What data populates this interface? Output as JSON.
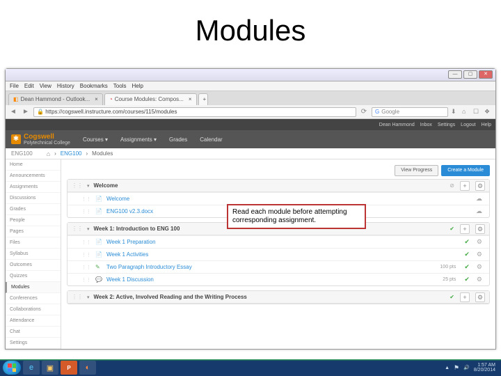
{
  "slide_title": "Modules",
  "browser_menu": [
    "File",
    "Edit",
    "View",
    "History",
    "Bookmarks",
    "Tools",
    "Help"
  ],
  "tabs": [
    {
      "label": "Dean Hammond - Outlook...",
      "active": false
    },
    {
      "label": "Course Modules: Compos...",
      "active": true
    }
  ],
  "url": "https://cogswell.instructure.com/courses/115/modules",
  "search_placeholder": "Google",
  "user_bar": {
    "user": "Dean Hammond",
    "links": [
      "Inbox",
      "Settings",
      "Logout",
      "Help"
    ]
  },
  "brand": {
    "name": "Cogswell",
    "sub": "Polytechnical College"
  },
  "global_nav": [
    "Courses ▾",
    "Assignments ▾",
    "Grades",
    "Calendar"
  ],
  "breadcrumb": [
    "ENG100",
    "Modules"
  ],
  "course_code": "ENG100",
  "sidebar": [
    "Home",
    "Announcements",
    "Assignments",
    "Discussions",
    "Grades",
    "People",
    "Pages",
    "Files",
    "Syllabus",
    "Outcomes",
    "Quizzes",
    "Modules",
    "Conferences",
    "Collaborations",
    "Attendance",
    "Chat",
    "Settings"
  ],
  "actions": {
    "progress": "View Progress",
    "create": "Create a Module"
  },
  "modules": [
    {
      "title": "Welcome",
      "published": false,
      "items": [
        {
          "icon": "page",
          "title": "Welcome",
          "cloud": true,
          "green": false
        },
        {
          "icon": "page",
          "title": "ENG100 v2.3.docx",
          "cloud": true,
          "green": true
        }
      ]
    },
    {
      "title": "Week 1: Introduction to ENG 100",
      "published": true,
      "items": [
        {
          "icon": "page",
          "title": "Week 1 Preparation",
          "green": true,
          "stat": true
        },
        {
          "icon": "page",
          "title": "Week 1 Activities",
          "green": true,
          "stat": true
        },
        {
          "icon": "assign",
          "title": "Two Paragraph Introductory Essay",
          "green": true,
          "pts": "100 pts",
          "stat": true
        },
        {
          "icon": "discuss",
          "title": "Week 1 Discussion",
          "green": true,
          "pts": "25 pts",
          "stat": true
        }
      ]
    },
    {
      "title": "Week 2: Active, Involved Reading and the Writing Process",
      "published": true,
      "items": []
    }
  ],
  "callout": "Read each module before attempting corresponding assignment.",
  "tray": {
    "time": "1:57 AM",
    "date": "8/20/2014"
  }
}
